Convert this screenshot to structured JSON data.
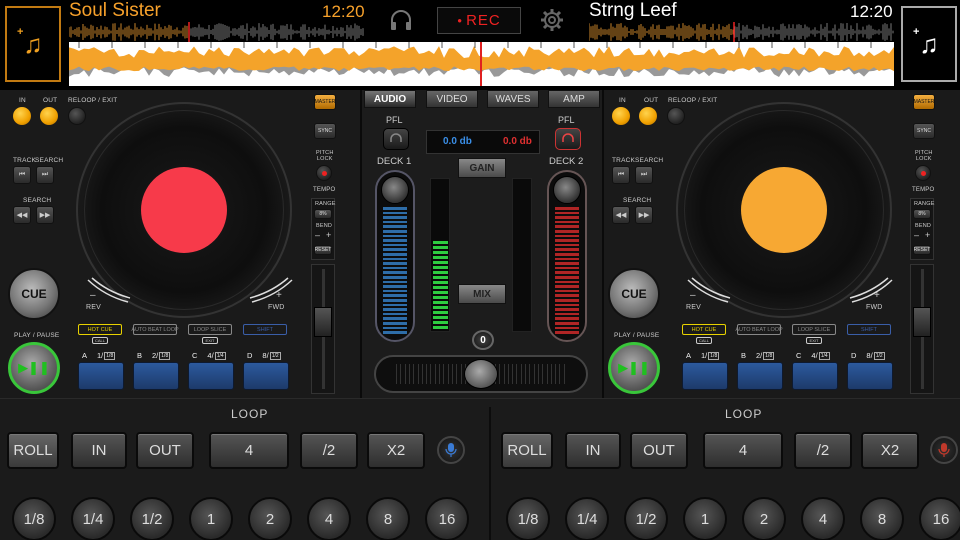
{
  "deckA": {
    "title": "Soul Sister",
    "time": "12:20",
    "disc_color": "#f73a4a",
    "labels": {
      "in": "IN",
      "out": "OUT",
      "reloop": "RELOOP / EXIT",
      "track": "TRACK",
      "search": "SEARCH",
      "search2": "SEARCH",
      "rev": "REV",
      "fwd": "FWD",
      "minus": "–",
      "plus": "+",
      "play_pause": "PLAY / PAUSE",
      "cue": "CUE"
    },
    "side": {
      "master": "MASTER",
      "sync": "SYNC",
      "pitch_lock": "PITCH\nLOCK",
      "tempo": "TEMPO",
      "range": "RANGE",
      "range_value": "8%",
      "bend": "BEND",
      "bend_minus": "–",
      "bend_plus": "+",
      "reset": "RESET"
    },
    "fx": [
      {
        "label": "HOT CUE",
        "sub": "CALL",
        "color": "#e8d200"
      },
      {
        "label": "AUTO BEAT LOOP",
        "sub": "",
        "color": "#888"
      },
      {
        "label": "LOOP SLICE",
        "sub": "EXIT",
        "color": "#888"
      },
      {
        "label": "SHIFT",
        "sub": "",
        "color": "#3a5ea8"
      }
    ],
    "pads": [
      {
        "letter": "A",
        "num": "1/",
        "box": "1/8"
      },
      {
        "letter": "B",
        "num": "2/",
        "box": "1/8"
      },
      {
        "letter": "C",
        "num": "4/",
        "box": "1/4"
      },
      {
        "letter": "D",
        "num": "8/",
        "box": "1/2"
      }
    ]
  },
  "deckB": {
    "title": "Strng Leef",
    "time": "12:20",
    "disc_color": "#f7a833",
    "labels": {
      "in": "IN",
      "out": "OUT",
      "reloop": "RELOOP / EXIT",
      "track": "TRACK",
      "search": "SEARCH",
      "search2": "SEARCH",
      "rev": "REV",
      "fwd": "FWD",
      "minus": "–",
      "plus": "+",
      "play_pause": "PLAY / PAUSE",
      "cue": "CUE"
    },
    "side": {
      "master": "MASTER",
      "sync": "SYNC",
      "pitch_lock": "PITCH\nLOCK",
      "tempo": "TEMPO",
      "range": "RANGE",
      "range_value": "8%",
      "bend": "BEND",
      "bend_minus": "–",
      "bend_plus": "+",
      "reset": "RESET"
    },
    "fx": [
      {
        "label": "HOT CUE",
        "sub": "CALL",
        "color": "#e8d200"
      },
      {
        "label": "AUTO BEAT LOOP",
        "sub": "",
        "color": "#888"
      },
      {
        "label": "LOOP SLICE",
        "sub": "EXIT",
        "color": "#888"
      },
      {
        "label": "SHIFT",
        "sub": "",
        "color": "#3a5ea8"
      }
    ],
    "pads": [
      {
        "letter": "A",
        "num": "1/",
        "box": "1/8"
      },
      {
        "letter": "B",
        "num": "2/",
        "box": "1/8"
      },
      {
        "letter": "C",
        "num": "4/",
        "box": "1/4"
      },
      {
        "letter": "D",
        "num": "8/",
        "box": "1/2"
      }
    ]
  },
  "header": {
    "rec_label": "REC"
  },
  "mixer": {
    "tabs": [
      "AUDIO",
      "VIDEO",
      "WAVES",
      "AMP"
    ],
    "pfl_left": "PFL",
    "pfl_right": "PFL",
    "db_left": "0.0 db",
    "db_right": "0.0 db",
    "gain": "GAIN",
    "mix": "MIX",
    "deck1": "DECK 1",
    "deck2": "DECK 2",
    "reset_round": "0",
    "vu_left_level": 0.6,
    "vu_right_level": 0.0,
    "crossfader_position": 0.5
  },
  "loop": {
    "title": "LOOP",
    "buttons": [
      "ROLL",
      "IN",
      "OUT",
      "4",
      "/2",
      "X2"
    ],
    "beats": [
      "1/8",
      "1/4",
      "1/2",
      "1",
      "2",
      "4",
      "8",
      "16"
    ]
  },
  "colors": {
    "accent_orange": "#f7a12b",
    "rec_red": "#e22222",
    "db_blue": "#3a8fe8",
    "db_red": "#e03030",
    "vu_green": "#2ecc40",
    "vol_blue": "#2e6da8",
    "vol_red": "#b02525",
    "pad_blue": "#2c5a9e"
  }
}
